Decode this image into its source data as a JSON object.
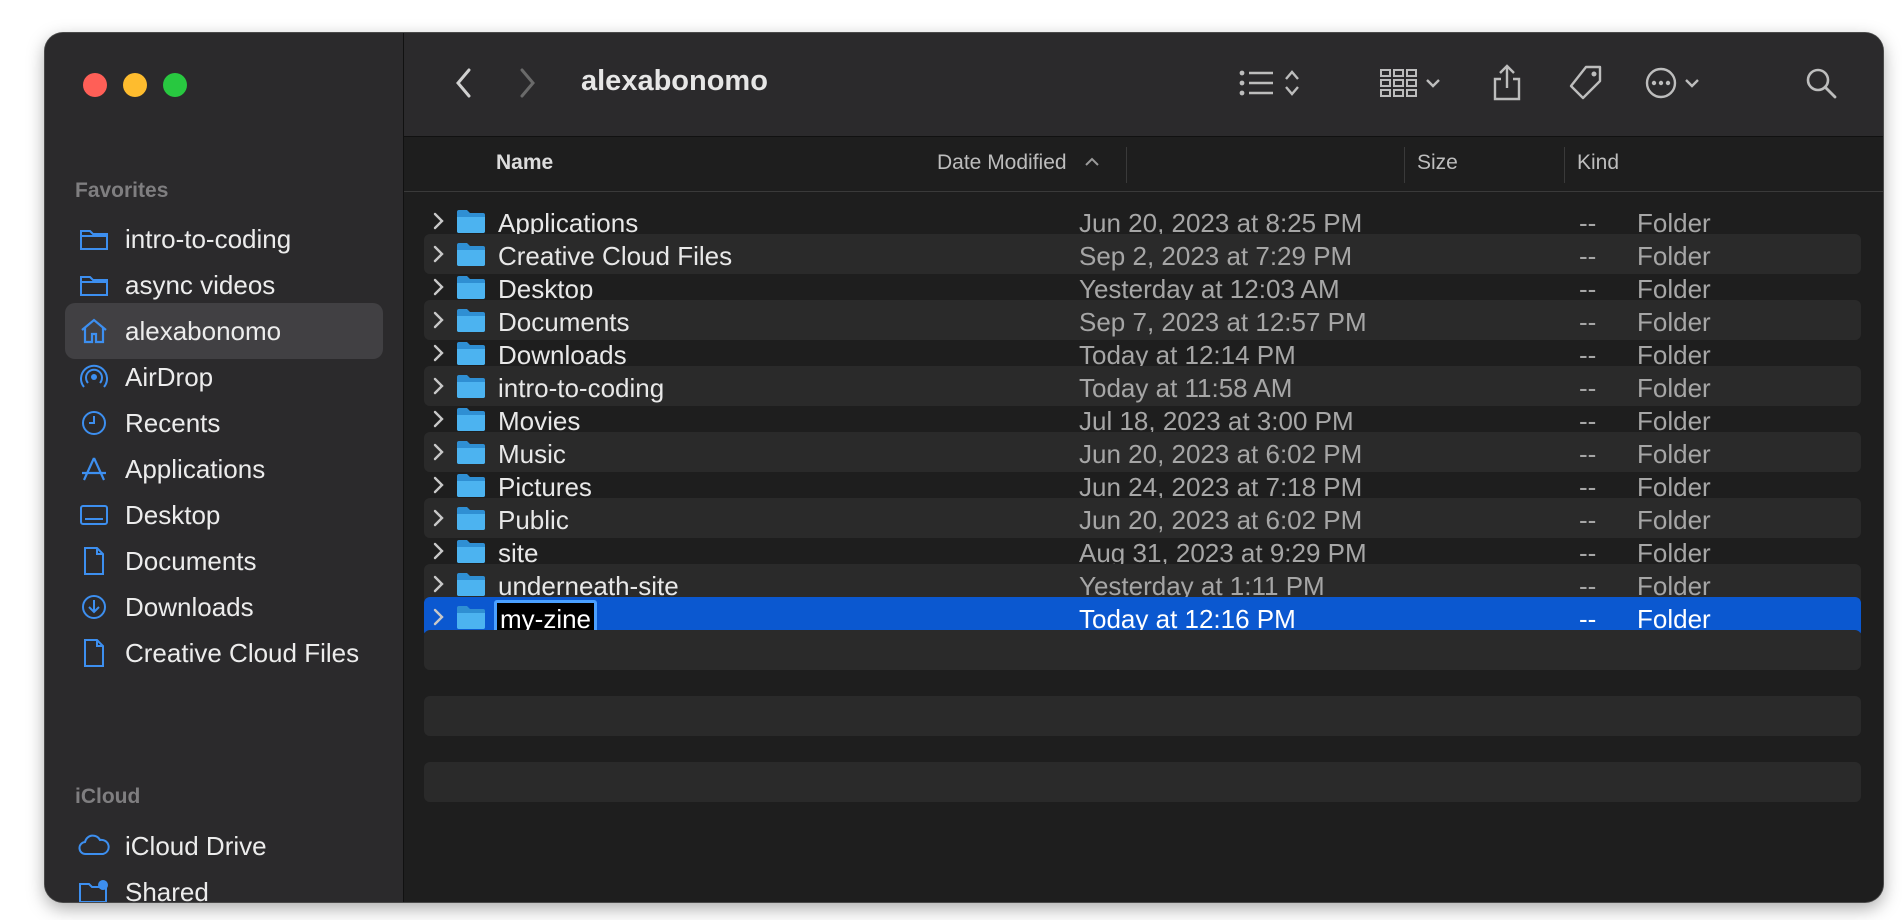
{
  "window": {
    "title": "alexabonomo"
  },
  "sidebar": {
    "favorites_label": "Favorites",
    "icloud_label": "iCloud",
    "favorites": [
      {
        "label": "intro-to-coding",
        "icon": "folder-icon"
      },
      {
        "label": "async videos",
        "icon": "folder-icon"
      },
      {
        "label": "alexabonomo",
        "icon": "home-icon",
        "selected": true
      },
      {
        "label": "AirDrop",
        "icon": "airdrop-icon"
      },
      {
        "label": "Recents",
        "icon": "clock-icon"
      },
      {
        "label": "Applications",
        "icon": "applications-icon"
      },
      {
        "label": "Desktop",
        "icon": "desktop-icon"
      },
      {
        "label": "Documents",
        "icon": "document-icon"
      },
      {
        "label": "Downloads",
        "icon": "download-icon"
      },
      {
        "label": "Creative Cloud Files",
        "icon": "file-icon"
      }
    ],
    "icloud": [
      {
        "label": "iCloud Drive",
        "icon": "cloud-icon"
      },
      {
        "label": "Shared",
        "icon": "shared-folder-icon"
      }
    ]
  },
  "columns": {
    "name": "Name",
    "date": "Date Modified",
    "size": "Size",
    "kind": "Kind"
  },
  "files": [
    {
      "name": "Applications",
      "date": "Jun 20, 2023 at 8:25 PM",
      "size": "--",
      "kind": "Folder"
    },
    {
      "name": "Creative Cloud Files",
      "date": "Sep 2, 2023 at 7:29 PM",
      "size": "--",
      "kind": "Folder"
    },
    {
      "name": "Desktop",
      "date": "Yesterday at 12:03 AM",
      "size": "--",
      "kind": "Folder"
    },
    {
      "name": "Documents",
      "date": "Sep 7, 2023 at 12:57 PM",
      "size": "--",
      "kind": "Folder"
    },
    {
      "name": "Downloads",
      "date": "Today at 12:14 PM",
      "size": "--",
      "kind": "Folder"
    },
    {
      "name": "intro-to-coding",
      "date": "Today at 11:58 AM",
      "size": "--",
      "kind": "Folder"
    },
    {
      "name": "Movies",
      "date": "Jul 18, 2023 at 3:00 PM",
      "size": "--",
      "kind": "Folder"
    },
    {
      "name": "Music",
      "date": "Jun 20, 2023 at 6:02 PM",
      "size": "--",
      "kind": "Folder"
    },
    {
      "name": "Pictures",
      "date": "Jun 24, 2023 at 7:18 PM",
      "size": "--",
      "kind": "Folder"
    },
    {
      "name": "Public",
      "date": "Jun 20, 2023 at 6:02 PM",
      "size": "--",
      "kind": "Folder"
    },
    {
      "name": "site",
      "date": "Aug 31, 2023 at 9:29 PM",
      "size": "--",
      "kind": "Folder"
    },
    {
      "name": "underneath-site",
      "date": "Yesterday at 1:11 PM",
      "size": "--",
      "kind": "Folder"
    },
    {
      "name": "my-zine",
      "date": "Today at 12:16 PM",
      "size": "--",
      "kind": "Folder",
      "selected": true,
      "editing": true
    }
  ],
  "colors": {
    "accent": "#0b58d0",
    "folder": "#3aa6e8",
    "sidebar_icon": "#3d8ff0"
  }
}
